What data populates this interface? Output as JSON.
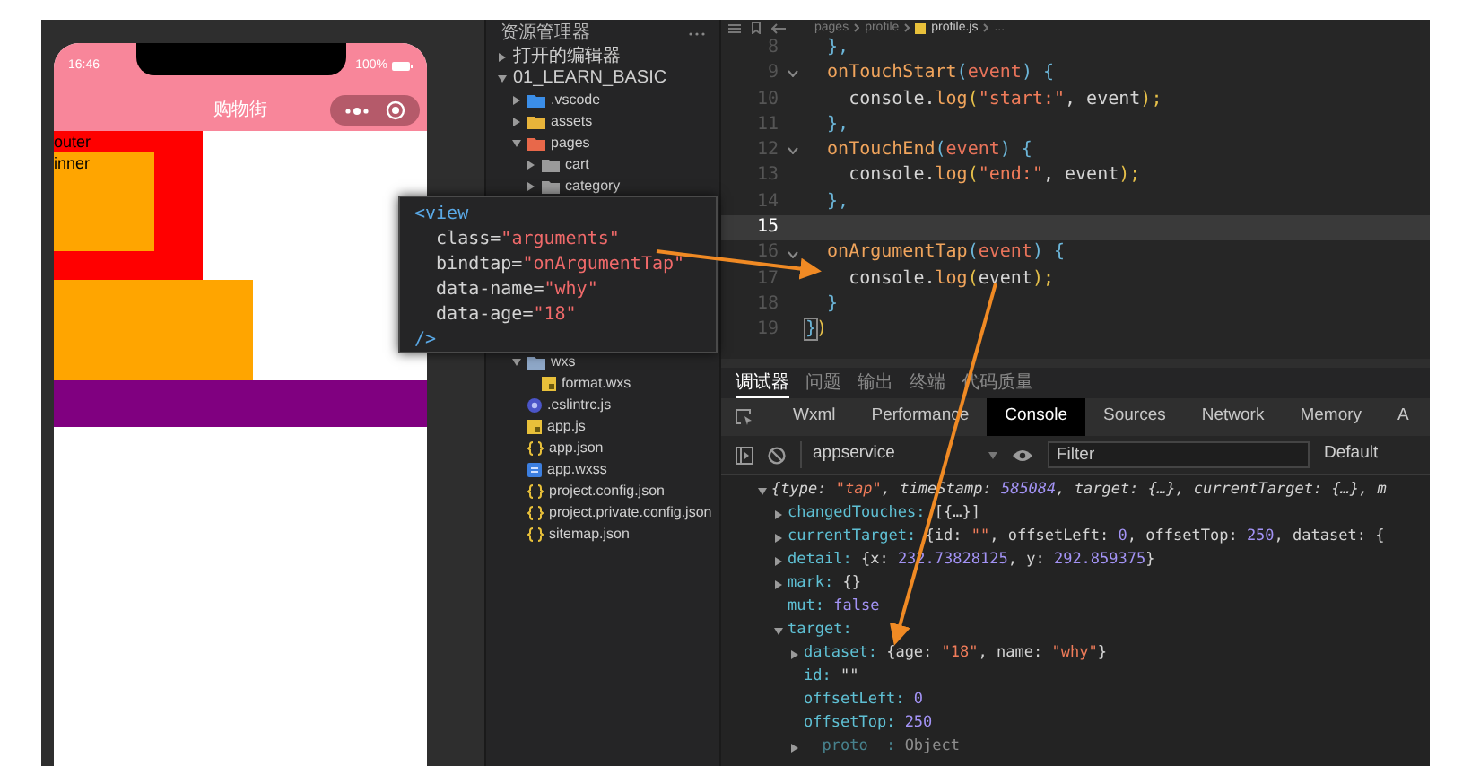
{
  "phone": {
    "time": "16:46",
    "battery": "100%",
    "nav_title": "购物街",
    "labels": [
      "outer",
      "inner"
    ]
  },
  "explorer": {
    "title": "资源管理器",
    "sections": [
      {
        "label": "打开的编辑器",
        "expanded": false
      },
      {
        "label": "01_LEARN_BASIC",
        "expanded": true,
        "children": [
          {
            "name": ".vscode",
            "kind": "folder",
            "color": "#3b8ee8",
            "expanded": false
          },
          {
            "name": "assets",
            "kind": "folder",
            "color": "#e8b43a",
            "expanded": false
          },
          {
            "name": "pages",
            "kind": "folder",
            "color": "#e8684a",
            "expanded": true,
            "children": [
              {
                "name": "cart",
                "kind": "folder",
                "color": "#9a9a9a",
                "expanded": false
              },
              {
                "name": "category",
                "kind": "folder",
                "color": "#9a9a9a",
                "expanded": false
              }
            ]
          },
          {
            "name": "wxs",
            "kind": "folder",
            "color": "#8fa8c8",
            "expanded": true,
            "children": [
              {
                "name": "format.wxs",
                "kind": "js"
              }
            ]
          },
          {
            "name": ".eslintrc.js",
            "kind": "eslint"
          },
          {
            "name": "app.js",
            "kind": "js"
          },
          {
            "name": "app.json",
            "kind": "json"
          },
          {
            "name": "app.wxss",
            "kind": "wxss"
          },
          {
            "name": "project.config.json",
            "kind": "json"
          },
          {
            "name": "project.private.config.json",
            "kind": "json"
          },
          {
            "name": "sitemap.json",
            "kind": "json"
          }
        ]
      }
    ]
  },
  "editor": {
    "breadcrumb": [
      "pages",
      "profile",
      "profile.js",
      "..."
    ],
    "lines": [
      {
        "number": "8",
        "foldable": false,
        "current": false,
        "tokens": [
          {
            "text": "  },",
            "kind": "punct"
          }
        ]
      },
      {
        "number": "9",
        "foldable": true,
        "current": false,
        "tokens": [
          {
            "text": "  onTouchStart",
            "kind": "fn"
          },
          {
            "text": "(",
            "kind": "punct"
          },
          {
            "text": "event",
            "kind": "param"
          },
          {
            "text": ") {",
            "kind": "punct"
          }
        ]
      },
      {
        "number": "10",
        "foldable": false,
        "current": false,
        "tokens": [
          {
            "text": "    console.",
            "kind": "plain"
          },
          {
            "text": "log",
            "kind": "fn"
          },
          {
            "text": "(",
            "kind": "paren"
          },
          {
            "text": "\"start:\"",
            "kind": "string"
          },
          {
            "text": ", event",
            "kind": "plain"
          },
          {
            "text": ");",
            "kind": "paren"
          }
        ]
      },
      {
        "number": "11",
        "foldable": false,
        "current": false,
        "tokens": [
          {
            "text": "  },",
            "kind": "punct"
          }
        ]
      },
      {
        "number": "12",
        "foldable": true,
        "current": false,
        "tokens": [
          {
            "text": "  onTouchEnd",
            "kind": "fn"
          },
          {
            "text": "(",
            "kind": "punct"
          },
          {
            "text": "event",
            "kind": "param"
          },
          {
            "text": ") {",
            "kind": "punct"
          }
        ]
      },
      {
        "number": "13",
        "foldable": false,
        "current": false,
        "tokens": [
          {
            "text": "    console.",
            "kind": "plain"
          },
          {
            "text": "log",
            "kind": "fn"
          },
          {
            "text": "(",
            "kind": "paren"
          },
          {
            "text": "\"end:\"",
            "kind": "string"
          },
          {
            "text": ", event",
            "kind": "plain"
          },
          {
            "text": ");",
            "kind": "paren"
          }
        ]
      },
      {
        "number": "14",
        "foldable": false,
        "current": false,
        "tokens": [
          {
            "text": "  },",
            "kind": "punct"
          }
        ]
      },
      {
        "number": "15",
        "foldable": false,
        "current": true
      },
      {
        "number": "16",
        "foldable": true,
        "current": false,
        "tokens": [
          {
            "text": "  onArgumentTap",
            "kind": "fn"
          },
          {
            "text": "(",
            "kind": "punct"
          },
          {
            "text": "event",
            "kind": "param"
          },
          {
            "text": ") {",
            "kind": "punct"
          }
        ]
      },
      {
        "number": "17",
        "foldable": false,
        "current": false,
        "tokens": [
          {
            "text": "    console.",
            "kind": "plain"
          },
          {
            "text": "log",
            "kind": "fn"
          },
          {
            "text": "(",
            "kind": "paren"
          },
          {
            "text": "event",
            "kind": "plain"
          },
          {
            "text": ");",
            "kind": "paren"
          }
        ]
      },
      {
        "number": "18",
        "foldable": false,
        "current": false,
        "tokens": [
          {
            "text": "  }",
            "kind": "punct"
          }
        ]
      },
      {
        "number": "19",
        "foldable": false,
        "current": false,
        "tokens": [
          {
            "text": "}",
            "kind": "match"
          },
          {
            "text": ")",
            "kind": "paren"
          }
        ]
      }
    ]
  },
  "snippet": {
    "lines": [
      [
        {
          "text": "<view",
          "kind": "tag"
        }
      ],
      [
        {
          "text": "  class=",
          "kind": "plain"
        },
        {
          "text": "\"arguments\"",
          "kind": "attr"
        }
      ],
      [
        {
          "text": "  bindtap=",
          "kind": "plain"
        },
        {
          "text": "\"onArgumentTap\"",
          "kind": "attr"
        }
      ],
      [
        {
          "text": "  data-name=",
          "kind": "plain"
        },
        {
          "text": "\"why\"",
          "kind": "attr"
        }
      ],
      [
        {
          "text": "  data-age=",
          "kind": "plain"
        },
        {
          "text": "\"18\"",
          "kind": "attr"
        }
      ],
      [
        {
          "text": "/>",
          "kind": "tag"
        }
      ]
    ]
  },
  "console": {
    "tabs": [
      {
        "label": "调试器",
        "selected": true
      },
      {
        "label": "问题",
        "selected": false
      },
      {
        "label": "输出",
        "selected": false
      },
      {
        "label": "终端",
        "selected": false
      },
      {
        "label": "代码质量",
        "selected": false
      }
    ],
    "devtools_tabs": [
      {
        "label": "Wxml",
        "selected": false
      },
      {
        "label": "Performance",
        "selected": false
      },
      {
        "label": "Console",
        "selected": true
      },
      {
        "label": "Sources",
        "selected": false
      },
      {
        "label": "Network",
        "selected": false
      },
      {
        "label": "Memory",
        "selected": false
      },
      {
        "label": "A",
        "selected": false
      }
    ],
    "context": "appservice",
    "filter": {
      "placeholder": "Filter"
    },
    "levels": "Default",
    "log": [
      {
        "kind": "object",
        "expanded": true,
        "tokens": [
          {
            "text": "{type: ",
            "kind": "plain"
          },
          {
            "text": "\"tap\"",
            "kind": "string"
          },
          {
            "text": ", timeStamp: ",
            "kind": "plain"
          },
          {
            "text": "585084",
            "kind": "number"
          },
          {
            "text": ", target: {…}, currentTarget: {…}, m",
            "kind": "plain"
          }
        ],
        "children": [
          {
            "kind": "object",
            "expanded": false,
            "key": "changedTouches:",
            "tokens": [
              {
                "text": "[{…}]",
                "kind": "plain"
              }
            ]
          },
          {
            "kind": "object",
            "expanded": false,
            "key": "currentTarget:",
            "tokens": [
              {
                "text": "{id: ",
                "kind": "plain"
              },
              {
                "text": "\"\"",
                "kind": "string"
              },
              {
                "text": ", offsetLeft: ",
                "kind": "plain"
              },
              {
                "text": "0",
                "kind": "number"
              },
              {
                "text": ", offsetTop: ",
                "kind": "plain"
              },
              {
                "text": "250",
                "kind": "number"
              },
              {
                "text": ", dataset: {",
                "kind": "plain"
              }
            ]
          },
          {
            "kind": "object",
            "expanded": false,
            "key": "detail:",
            "tokens": [
              {
                "text": "{x: ",
                "kind": "plain"
              },
              {
                "text": "232.73828125",
                "kind": "number"
              },
              {
                "text": ", y: ",
                "kind": "plain"
              },
              {
                "text": "292.859375",
                "kind": "number"
              },
              {
                "text": "}",
                "kind": "plain"
              }
            ]
          },
          {
            "kind": "object",
            "expanded": false,
            "key": "mark:",
            "tokens": [
              {
                "text": "{}",
                "kind": "plain"
              }
            ]
          },
          {
            "kind": "value",
            "key": "mut:",
            "tokens": [
              {
                "text": "false",
                "kind": "number"
              }
            ]
          },
          {
            "kind": "object",
            "expanded": true,
            "key": "target:",
            "children": [
              {
                "kind": "object",
                "expanded": false,
                "key": "dataset:",
                "tokens": [
                  {
                    "text": "{age: ",
                    "kind": "plain"
                  },
                  {
                    "text": "\"18\"",
                    "kind": "string"
                  },
                  {
                    "text": ", name: ",
                    "kind": "plain"
                  },
                  {
                    "text": "\"why\"",
                    "kind": "string"
                  },
                  {
                    "text": "}",
                    "kind": "plain"
                  }
                ]
              },
              {
                "kind": "value",
                "key": "id:",
                "tokens": [
                  {
                    "text": "\"\"",
                    "kind": "plain"
                  }
                ]
              },
              {
                "kind": "value",
                "key": "offsetLeft:",
                "tokens": [
                  {
                    "text": "0",
                    "kind": "number"
                  }
                ]
              },
              {
                "kind": "value",
                "key": "offsetTop:",
                "tokens": [
                  {
                    "text": "250",
                    "kind": "number"
                  }
                ]
              },
              {
                "kind": "object",
                "expanded": false,
                "key": "__proto__:",
                "dim": true,
                "tokens": [
                  {
                    "text": "Object",
                    "kind": "plain"
                  }
                ]
              }
            ]
          }
        ]
      }
    ]
  }
}
